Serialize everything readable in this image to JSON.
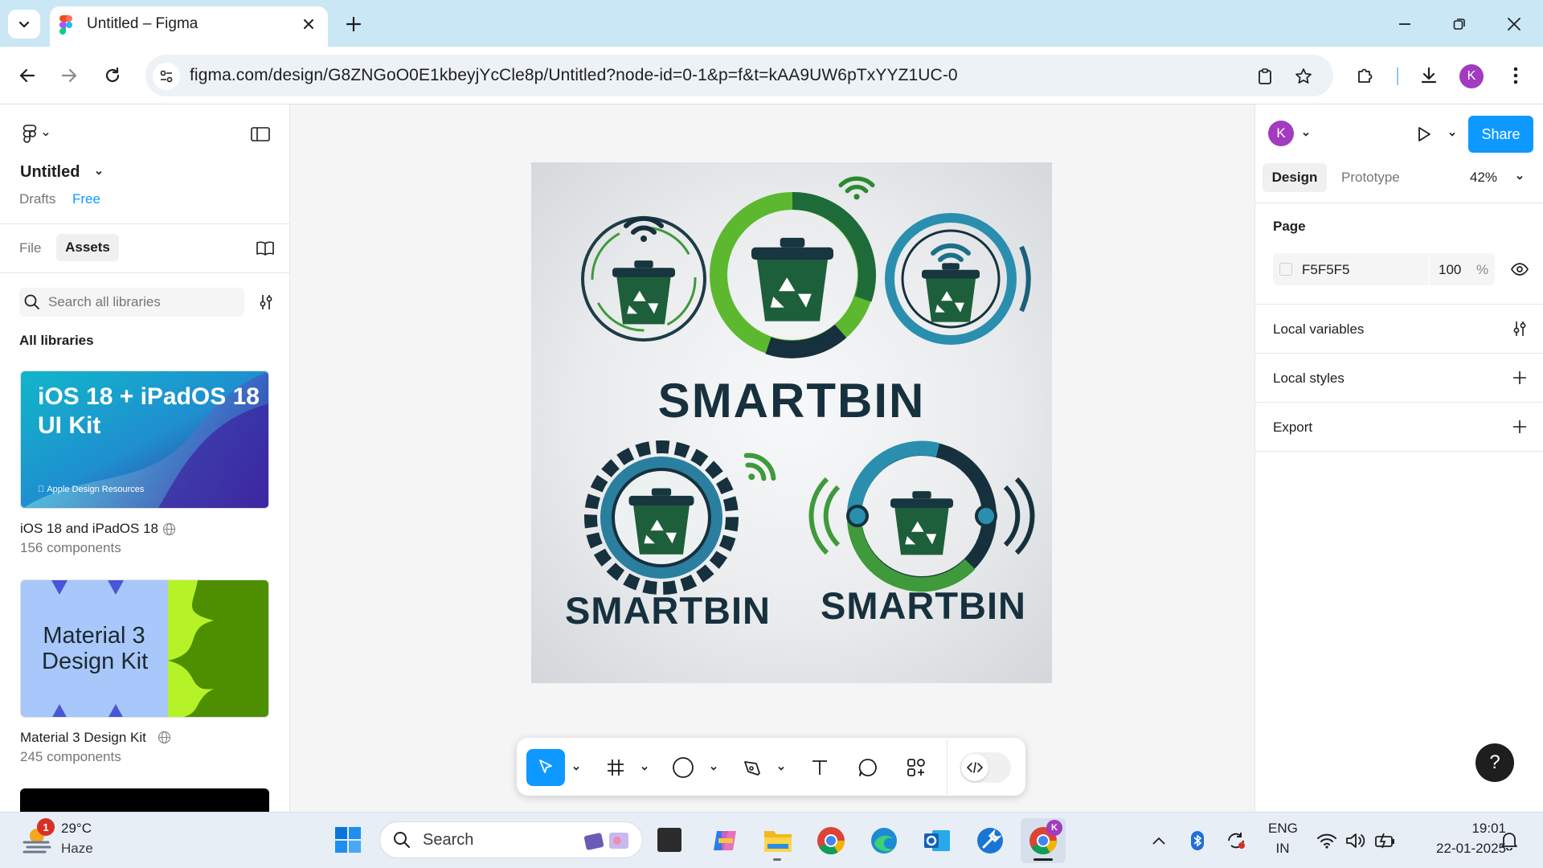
{
  "browser": {
    "tab_title": "Untitled – Figma",
    "url": "figma.com/design/G8ZNGoO0E1kbeyjYcCle8p/Untitled?node-id=0-1&p=f&t=kAA9UW6pTxYYZ1UC-0",
    "profile_initial": "K"
  },
  "left_panel": {
    "file_name": "Untitled",
    "location": "Drafts",
    "plan_badge": "Free",
    "tabs": [
      "File",
      "Assets"
    ],
    "active_tab": "Assets",
    "search_placeholder": "Search all libraries",
    "section_title": "All libraries",
    "libraries": [
      {
        "thumb_title": "iOS 18 + iPadOS 18 UI Kit",
        "thumb_line1": "iOS 18 + iPadOS 18",
        "thumb_line2": "UI Kit",
        "thumb_footer": "Apple Design Resources",
        "name": "iOS 18 and iPadOS 18",
        "count": "156 components"
      },
      {
        "thumb_line1": "Material 3",
        "thumb_line2": "Design Kit",
        "name": "Material 3 Design Kit",
        "count": "245 components"
      }
    ]
  },
  "artwork": {
    "wordmarks": [
      "SMARTBIN",
      "SMARTBIN",
      "SMARTBIN"
    ]
  },
  "toolbar_tools": [
    "move-tool",
    "frame-tool",
    "shape-tool",
    "pen-tool",
    "text-tool",
    "comment-tool",
    "actions-tool",
    "dev-mode-toggle"
  ],
  "right_panel": {
    "avatar_initial": "K",
    "share_label": "Share",
    "tabs": [
      "Design",
      "Prototype"
    ],
    "active_tab": "Design",
    "zoom": "42%",
    "page_label": "Page",
    "page_color_hex": "F5F5F5",
    "page_opacity": "100",
    "percent_sign": "%",
    "sections": [
      "Local variables",
      "Local styles",
      "Export"
    ]
  },
  "help_label": "?",
  "taskbar": {
    "weather_temp": "29°C",
    "weather_desc": "Haze",
    "weather_badge": "1",
    "search_placeholder": "Search",
    "lang_line1": "ENG",
    "lang_line2": "IN",
    "time": "19:01",
    "date": "22-01-2025",
    "chrome_badge": "K"
  },
  "colors": {
    "figma_blue": "#0d99ff",
    "avatar_purple": "#a23bbf",
    "chrome_tab_strip": "#c9e7f5",
    "smartbin_green": "#3e9a3a",
    "smartbin_navy": "#16313d",
    "smartbin_teal": "#2a8fae"
  }
}
